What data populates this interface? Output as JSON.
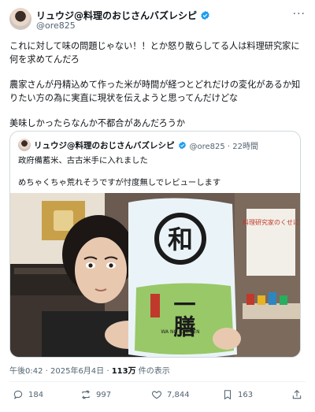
{
  "post": {
    "display_name": "リュウジ@料理のおじさんバズレシピ",
    "handle": "@ore825",
    "more_icon": "more-icon",
    "paragraphs": [
      "これに対して味の問題じゃない！！とか怒り散らしてる人は料理研究家に何を求めてんだろ",
      "農家さんが丹精込めて作った米が時間が経つとどれだけの変化があるか知りたい方の為に実直に現状を伝えようと思ってんだけどな",
      "美味しかったらなんか不都合があんだろうか"
    ],
    "timestamp": "午後0:42 · 2025年6月4日 · ",
    "views_count": "113万",
    "views_label": " 件の表示"
  },
  "quote": {
    "display_name": "リュウジ@料理のおじさんバズレシピ",
    "handle_time": "@ore825 · 22時間",
    "lines": [
      "政府備蓄米、古古米手に入れました",
      "めちゃくちゃ荒れそうですが忖度無しでレビューします"
    ],
    "image": {
      "bag_brand": "和",
      "bag_name": "一膳",
      "bag_romaji": "WA NO ICHI ZEN",
      "poster_text": "料理研究家のくせに"
    }
  },
  "actions": {
    "replies": "184",
    "reposts": "997",
    "likes": "7,844",
    "bookmarks": "163"
  },
  "colors": {
    "text": "#0f1419",
    "secondary": "#536471",
    "verified": "#1d9bf0",
    "border": "#cfd9de"
  }
}
